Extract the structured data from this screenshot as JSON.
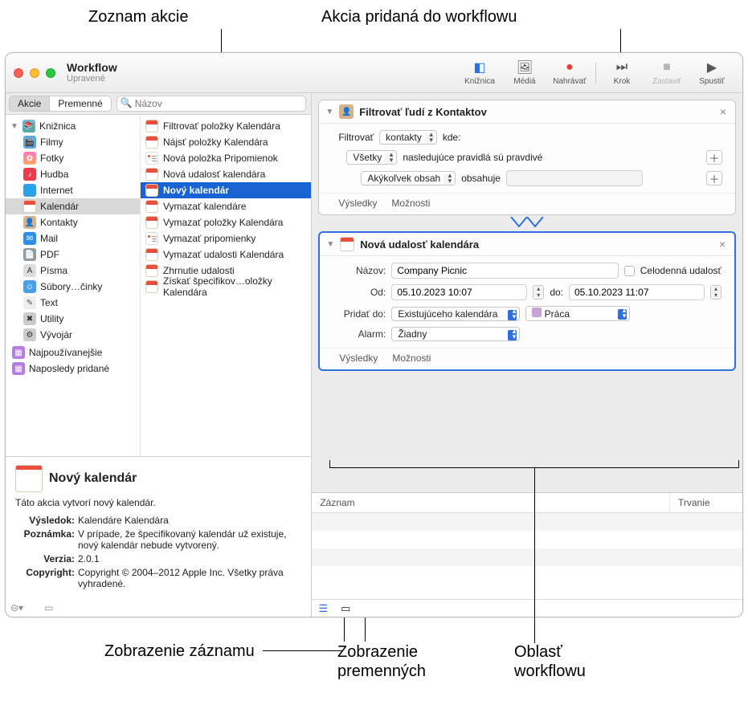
{
  "callouts": {
    "actions_list": "Zoznam akcie",
    "action_added": "Akcia pridaná do workflowu",
    "log_view": "Zobrazenie záznamu",
    "vars_view": "Zobrazenie premenných",
    "wf_area": "Oblasť workflowu"
  },
  "window": {
    "title": "Workflow",
    "subtitle": "Upravené"
  },
  "toolbar": {
    "library": "Knižnica",
    "media": "Médiá",
    "record": "Nahrávať",
    "step": "Krok",
    "stop": "Zastaviť",
    "run": "Spustiť"
  },
  "left_tabs": {
    "actions": "Akcie",
    "variables": "Premenné",
    "search_placeholder": "Názov"
  },
  "library": {
    "root": "Knižnica",
    "items": [
      "Filmy",
      "Fotky",
      "Hudba",
      "Internet",
      "Kalendár",
      "Kontakty",
      "Mail",
      "PDF",
      "Písma",
      "Súbory…činky",
      "Text",
      "Utility",
      "Vývojár"
    ],
    "extra": [
      "Najpoužívanejšie",
      "Naposledy pridané"
    ]
  },
  "actions_list": [
    "Filtrovať položky Kalendára",
    "Nájsť položky Kalendára",
    "Nová položka Pripomienok",
    "Nová udalosť kalendára",
    "Nový kalendár",
    "Vymazať kalendáre",
    "Vymazať položky Kalendára",
    "Vymazať pripomienky",
    "Vymazať udalosti Kalendára",
    "Zhrnutie udalosti",
    "Získať špecifikov…oložky Kalendára"
  ],
  "info": {
    "title": "Nový kalendár",
    "desc": "Táto akcia vytvorí nový kalendár.",
    "rows": {
      "result_k": "Výsledok:",
      "result_v": "Kalendáre Kalendára",
      "note_k": "Poznámka:",
      "note_v": "V prípade, že špecifikovaný kalendár už existuje, nový kalendár nebude vytvorený.",
      "version_k": "Verzia:",
      "version_v": "2.0.1",
      "copyright_k": "Copyright:",
      "copyright_v": "Copyright © 2004–2012 Apple Inc. Všetky práva vyhradené."
    }
  },
  "wf": {
    "a1": {
      "title": "Filtrovať ľudí z Kontaktov",
      "filter_label": "Filtrovať",
      "filter_val": "kontakty",
      "where": "kde:",
      "all": "Všetky",
      "rule_text": "nasledujúce pravidlá sú pravdivé",
      "any_content": "Akýkoľvek obsah",
      "contains": "obsahuje",
      "results": "Výsledky",
      "options": "Možnosti"
    },
    "a2": {
      "title": "Nová udalosť kalendára",
      "name_k": "Názov:",
      "name_v": "Company Picnic",
      "allday": "Celodenná udalosť",
      "from_k": "Od:",
      "from_v": "05.10.2023 10:07",
      "to_k": "do:",
      "to_v": "05.10.2023 11:07",
      "addto_k": "Pridať do:",
      "addto_v": "Existujúceho kalendára",
      "cal_name": "Práca",
      "alarm_k": "Alarm:",
      "alarm_v": "Žiadny",
      "results": "Výsledky",
      "options": "Možnosti"
    }
  },
  "log": {
    "col1": "Záznam",
    "col2": "Trvanie"
  }
}
